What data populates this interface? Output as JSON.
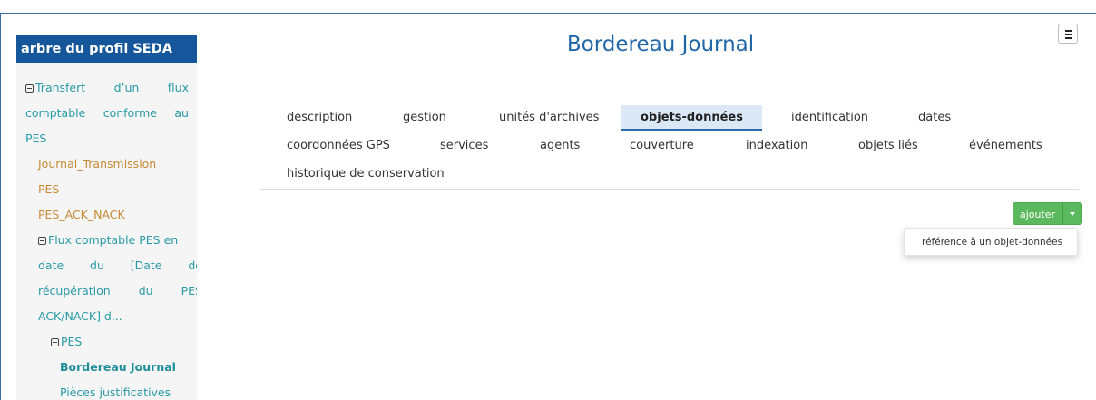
{
  "sidebar": {
    "title": "arbre du profil SEDA",
    "tree": [
      {
        "words": [
          "Transfert",
          "d’un",
          "flux"
        ],
        "has_toggle": true
      },
      {
        "words": [
          "comptable",
          "conforme",
          "au"
        ]
      },
      {
        "text": "PES"
      },
      {
        "text": "Journal_Transmission"
      },
      {
        "text": "PES"
      },
      {
        "text": "PES_ACK_NACK"
      },
      {
        "words": [
          "Flux comptable PES en"
        ],
        "has_toggle": true
      },
      {
        "words": [
          "date",
          "du",
          "[Date",
          "de"
        ]
      },
      {
        "words": [
          "récupération",
          "du",
          "PES"
        ]
      },
      {
        "text": "ACK/NACK] d..."
      },
      {
        "text": "PES",
        "has_toggle": true
      },
      {
        "text": "Bordereau Journal"
      },
      {
        "text": "Pièces justificatives"
      }
    ]
  },
  "page": {
    "title": "Bordereau Journal"
  },
  "tabs": [
    {
      "label": "description"
    },
    {
      "label": "gestion"
    },
    {
      "label": "unités d'archives"
    },
    {
      "label": "objets-données",
      "active": true
    },
    {
      "label": "identification"
    },
    {
      "label": "dates"
    },
    {
      "label": "coordonnées GPS"
    },
    {
      "label": "services"
    },
    {
      "label": "agents"
    },
    {
      "label": "couverture"
    },
    {
      "label": "indexation"
    },
    {
      "label": "objets liés"
    },
    {
      "label": "événements"
    },
    {
      "label": "historique de conservation"
    }
  ],
  "actions": {
    "add_label": "ajouter",
    "dropdown_items": [
      "référence à un objet-données"
    ]
  },
  "icons": {
    "menu": "hamburger-icon",
    "caret": "caret-down-icon",
    "tree_toggle": "collapse-toggle-icon"
  },
  "colors": {
    "sidebar_header": "#16569b",
    "title": "#2067a8",
    "link": "#2a9aa6",
    "leaf_link": "#c68a36",
    "active_tab_bg": "#dbe8f6",
    "add_button": "#5cb85c"
  }
}
